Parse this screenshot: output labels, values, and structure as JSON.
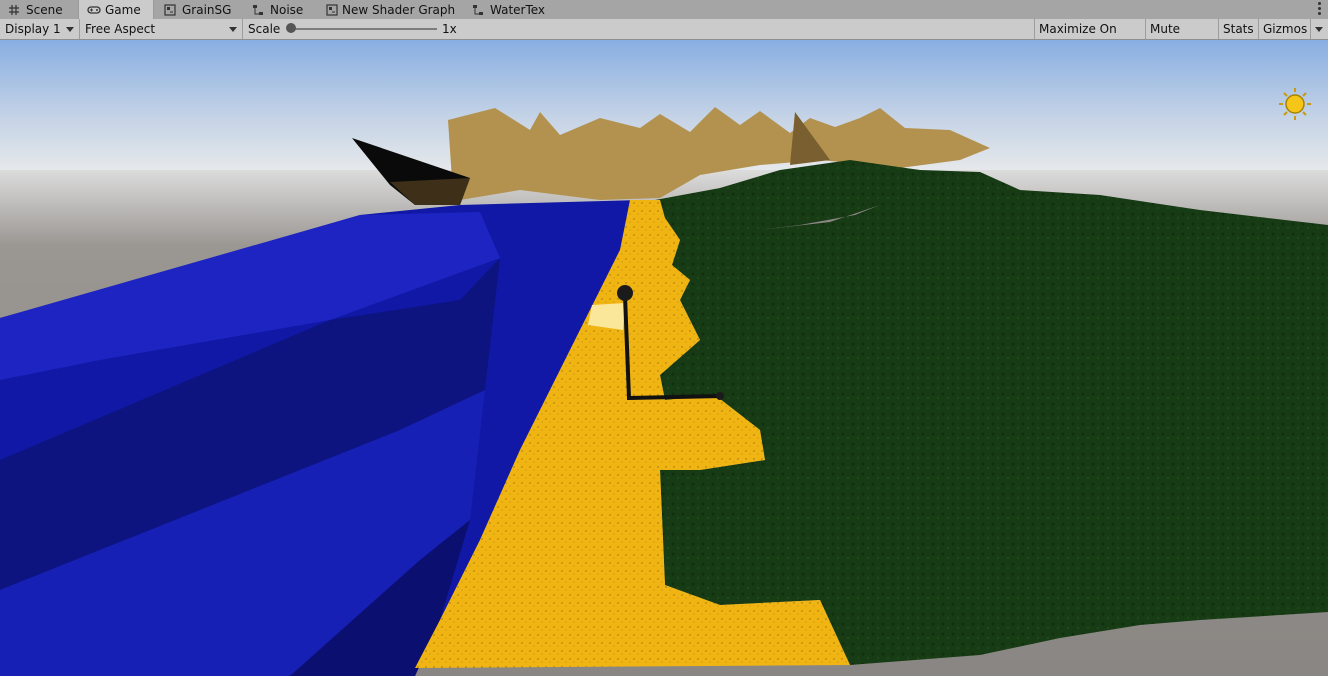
{
  "tabs": [
    {
      "label": "Scene",
      "icon": "grid-icon",
      "active": false
    },
    {
      "label": "Game",
      "icon": "gamepad-icon",
      "active": true
    },
    {
      "label": "GrainSG",
      "icon": "shader-graph-icon",
      "active": false
    },
    {
      "label": "Noise",
      "icon": "node-graph-icon",
      "active": false
    },
    {
      "label": "New Shader Graph",
      "icon": "shader-graph-icon",
      "active": false
    },
    {
      "label": "WaterTex",
      "icon": "node-graph-icon",
      "active": false
    }
  ],
  "toolbar": {
    "display": "Display 1",
    "aspect": "Free Aspect",
    "scale_label": "Scale",
    "scale_value": "1x",
    "maximize_on_play": "Maximize On Play",
    "mute_audio": "Mute Audio",
    "stats": "Stats",
    "gizmos": "Gizmos"
  },
  "colors": {
    "sky_top": "#8fb4e6",
    "horizon": "#e8e8e8",
    "ground": "#8a8683",
    "water": "#0f1aa8",
    "sand": "#f0b512",
    "grass": "#173b14",
    "mountains": "#b09050"
  }
}
